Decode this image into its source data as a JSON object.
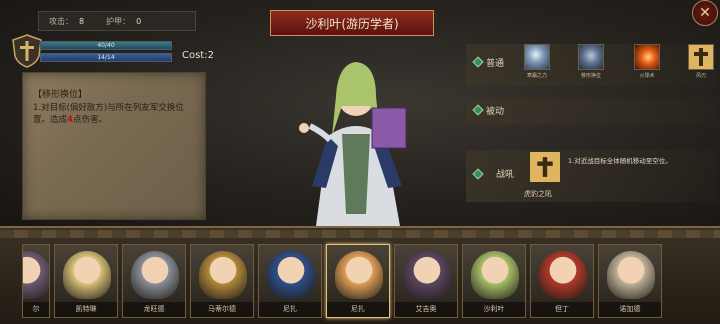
{
  "stats": {
    "attack_label": "攻击：",
    "attack_value": "8",
    "armor_label": "护甲：",
    "armor_value": "0"
  },
  "bars": {
    "hp_text": "40/40",
    "hp_fraction": 1.0,
    "mp_text": "14/14",
    "mp_fraction": 1.0
  },
  "cost": "Cost:2",
  "skill_detail": {
    "title": "【移形换位】",
    "desc_before": "1.对目标(偏好敌方)与所在列友军交换位置。造成",
    "damage": "4",
    "desc_after": "点伤害。"
  },
  "hero_name": "沙利叶(游历学者)",
  "skills": {
    "normal_label": "普通",
    "passive_label": "被动",
    "battlecry_label": "战吼",
    "normal": [
      {
        "name": "寒霜之力",
        "icon": "frost-icon"
      },
      {
        "name": "移形换位",
        "icon": "swap-icon"
      },
      {
        "name": "火球术",
        "icon": "fireball-icon"
      },
      {
        "name": "风刃",
        "icon": "cross-icon"
      }
    ],
    "battlecry": {
      "name": "虎豹之吼",
      "icon": "cross-icon",
      "desc": "1.对近战目标全体随机移动至空位。"
    }
  },
  "roster": [
    {
      "name": "尔",
      "partial": true,
      "color": "#6d5a72"
    },
    {
      "name": "凯特琳",
      "color": "#d9c27a"
    },
    {
      "name": "龙旺德",
      "color": "#8a8f98"
    },
    {
      "name": "马蒂尔德",
      "color": "#b38a3c"
    },
    {
      "name": "尼扎",
      "color": "#2f4f8a"
    },
    {
      "name": "尼扎",
      "color": "#e0a057",
      "active": true
    },
    {
      "name": "艾吉奥",
      "color": "#5b4662"
    },
    {
      "name": "沙利叶",
      "color": "#a8c06a"
    },
    {
      "name": "但丁",
      "color": "#b0392a"
    },
    {
      "name": "诺加德",
      "color": "#bfb29a"
    }
  ],
  "colors": {
    "banner": "#8e2a1e",
    "accent_gold": "#e4c37d",
    "damage_red": "#b01a0f"
  }
}
